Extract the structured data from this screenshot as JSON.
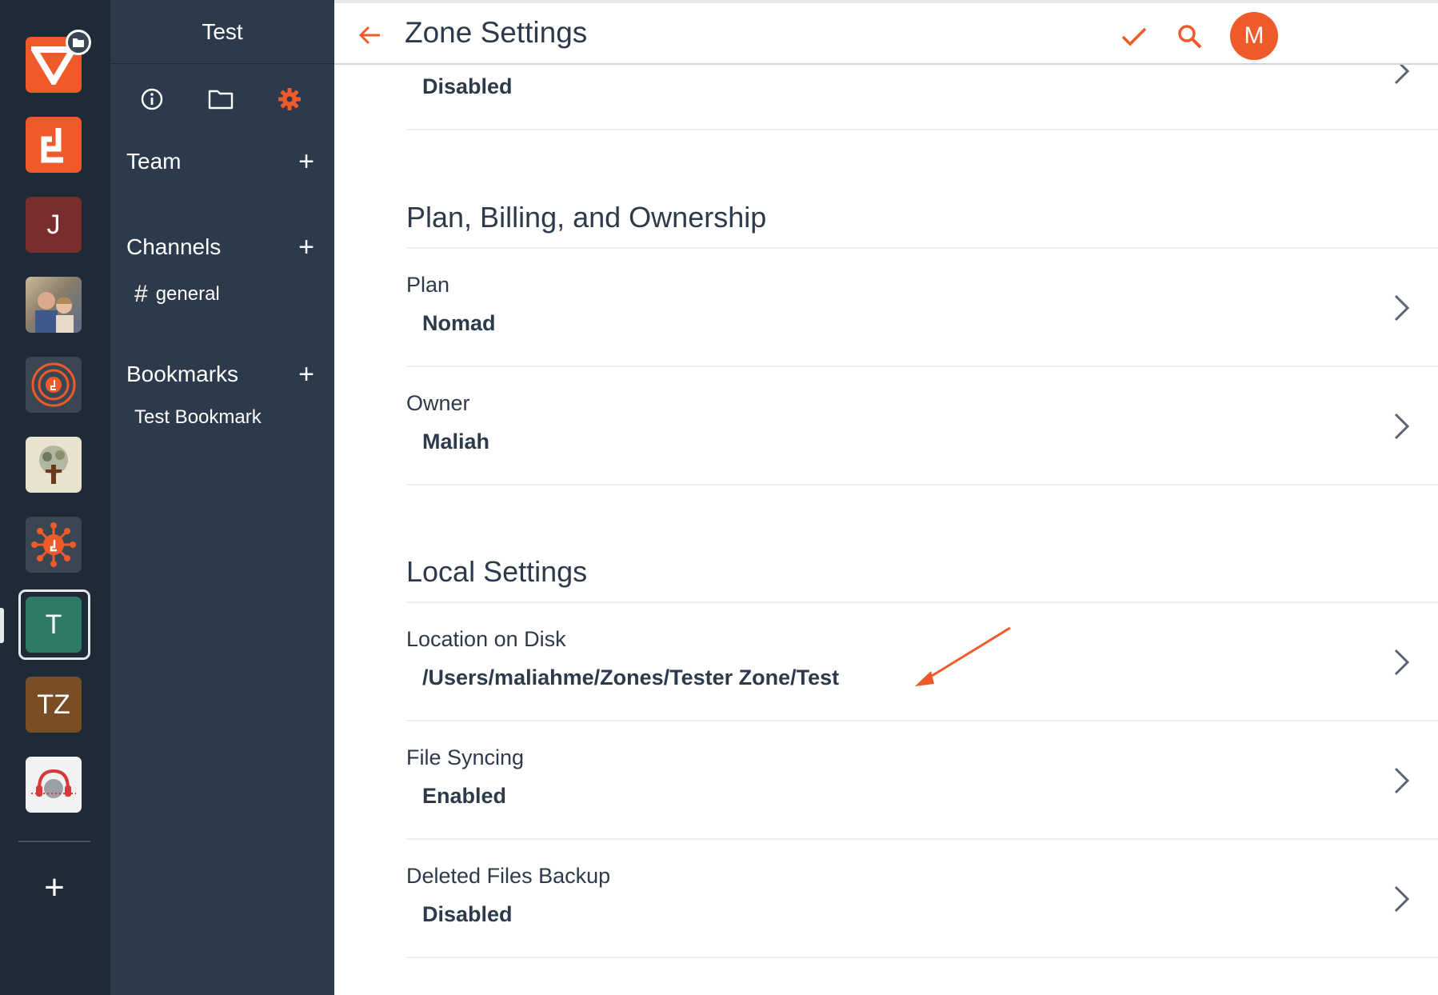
{
  "sidebar": {
    "title": "Test",
    "sections": {
      "team": {
        "label": "Team"
      },
      "channels": {
        "label": "Channels",
        "items": [
          {
            "label": "general"
          }
        ]
      },
      "bookmarks": {
        "label": "Bookmarks",
        "items": [
          {
            "label": "Test Bookmark"
          }
        ]
      }
    },
    "tabs": [
      "info-icon",
      "folder-icon",
      "gear-icon"
    ]
  },
  "rail": {
    "items": [
      {
        "name": "zone-logo-v",
        "color": "#ef5a2a"
      },
      {
        "name": "zone-logo-d",
        "color": "#ef5a2a"
      },
      {
        "name": "zone-j",
        "letter": "J",
        "color": "#7a2d2d"
      },
      {
        "name": "zone-photo-couple",
        "color": "#8a7d6a"
      },
      {
        "name": "zone-logo-circle",
        "color": "#3b4653"
      },
      {
        "name": "zone-logo-tree",
        "color": "#e9e2cf"
      },
      {
        "name": "zone-logo-network",
        "color": "#3b4653"
      },
      {
        "name": "zone-t",
        "letter": "T",
        "color": "#2f7a67"
      },
      {
        "name": "zone-tz",
        "letter": "TZ",
        "color": "#7a4e25"
      },
      {
        "name": "zone-logo-headphones",
        "color": "#f2f2f2"
      }
    ]
  },
  "header": {
    "title": "Zone Settings",
    "avatar_initial": "M"
  },
  "content": {
    "top_row": {
      "label": "",
      "value": "Disabled"
    },
    "sections": [
      {
        "title": "Plan, Billing, and Ownership",
        "rows": [
          {
            "label": "Plan",
            "value": "Nomad"
          },
          {
            "label": "Owner",
            "value": "Maliah"
          }
        ]
      },
      {
        "title": "Local Settings",
        "rows": [
          {
            "label": "Location on Disk",
            "value": "/Users/maliahme/Zones/Tester Zone/Test"
          },
          {
            "label": "File Syncing",
            "value": "Enabled"
          },
          {
            "label": "Deleted Files Backup",
            "value": "Disabled"
          }
        ]
      }
    ]
  },
  "colors": {
    "accent": "#ef5a2a",
    "rail_bg": "#1f2a37",
    "sidebar_bg": "#2c3a4b",
    "text": "#2c3a4b"
  }
}
